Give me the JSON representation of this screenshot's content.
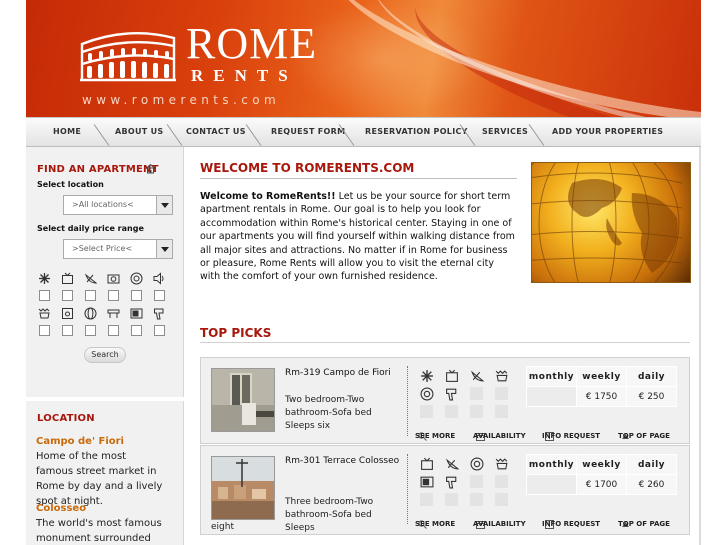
{
  "brand": {
    "name": "ROME",
    "tagline": "RENTS",
    "url": "www.romerents.com"
  },
  "nav": [
    {
      "label": "HOME"
    },
    {
      "label": "ABOUT US"
    },
    {
      "label": "CONTACT US"
    },
    {
      "label": "REQUEST FORM"
    },
    {
      "label": "RESERVATION POLICY"
    },
    {
      "label": "SERVICES"
    },
    {
      "label": "ADD YOUR PROPERTIES"
    }
  ],
  "sidebar": {
    "find_title": "FIND AN APARTMENT",
    "select_location_label": "Select location",
    "location_value": ">All locations<",
    "price_label": "Select daily price range",
    "price_value": ">Select Price<",
    "amenities": [
      "air-conditioning-icon",
      "tv-icon",
      "satellite-dish-icon",
      "dishwasher-icon",
      "washing-machine-icon",
      "speaker-icon",
      "bathtub-icon",
      "oven-icon",
      "internet-icon",
      "stove-icon",
      "microwave-icon",
      "hair-dryer-icon"
    ],
    "search_label": "Search",
    "location_title": "LOCATION",
    "locations": [
      {
        "name": "Campo de' Fiori",
        "desc": "Home of the most famous street market in Rome by day and a lively spot at night."
      },
      {
        "name": "Colosseo",
        "desc": "The world's most famous monument surrounded by a"
      }
    ]
  },
  "main": {
    "welcome_title": "WELCOME TO ROMERENTS.COM",
    "welcome_lead": "Welcome to RomeRents!!",
    "welcome_body": " Let us be your source for short term apartment rentals in Rome. Our goal is to help you look for accommodation within Rome's historical center. Staying in one of our apartments you will find yourself within walking distance from all major sites and attractions. No matter if in Rome for business or pleasure, Rome Rents will allow you to visit the eternal city with the comfort of your own furnished residence.",
    "top_picks_title": "TOP PICKS",
    "price_headers": [
      "monthly",
      "weekly",
      "daily"
    ],
    "action_labels": [
      "SEE MORE",
      "AVAILABILITY",
      "INFO REQUEST",
      "TOP OF PAGE"
    ],
    "listings": [
      {
        "name": "Rm-319 Campo de Fiori",
        "desc": "Two bedroom-Two bathroom-Sofa bed Sleeps six",
        "desc_extra": "",
        "monthly": "",
        "weekly": "€ 1750",
        "daily": "€ 250"
      },
      {
        "name": "Rm-301 Terrace Colosseo",
        "desc": "Three bedroom-Two bathroom-Sofa bed Sleeps",
        "desc_extra": "eight",
        "monthly": "",
        "weekly": "€ 1700",
        "daily": "€ 260"
      }
    ]
  },
  "colors": {
    "accent_red": "#a8170c",
    "location_orange": "#c96a0a",
    "header_orange": "#e05515"
  }
}
